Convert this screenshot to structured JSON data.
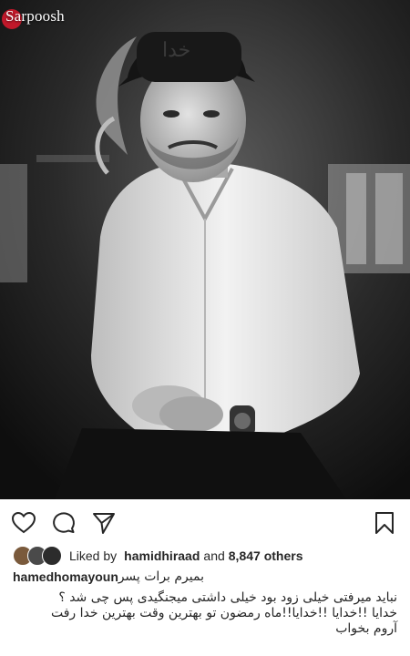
{
  "watermark": {
    "brand": "Sarpoosh"
  },
  "actions": {
    "like_icon": "heart-icon",
    "comment_icon": "comment-icon",
    "share_icon": "paper-plane-icon",
    "save_icon": "bookmark-icon"
  },
  "likes": {
    "prefix": "Liked by",
    "user": "hamidhiraad",
    "conjunction": "and",
    "others": "8,847 others"
  },
  "caption": {
    "username": "hamedhomayoun",
    "first_line": "بمیرم برات پسر",
    "lines": [
      "نباید میرفتی خیلی زود بود خیلی داشتی میجنگیدی پس چی شد ؟",
      "خدایا !!خدایا !!خدایا!!ماه رمضون تو بهترین وقت بهترین خدا رفت",
      "آروم بخواب"
    ]
  },
  "colors": {
    "text": "#262626",
    "watermark_red": "#c0182a"
  }
}
